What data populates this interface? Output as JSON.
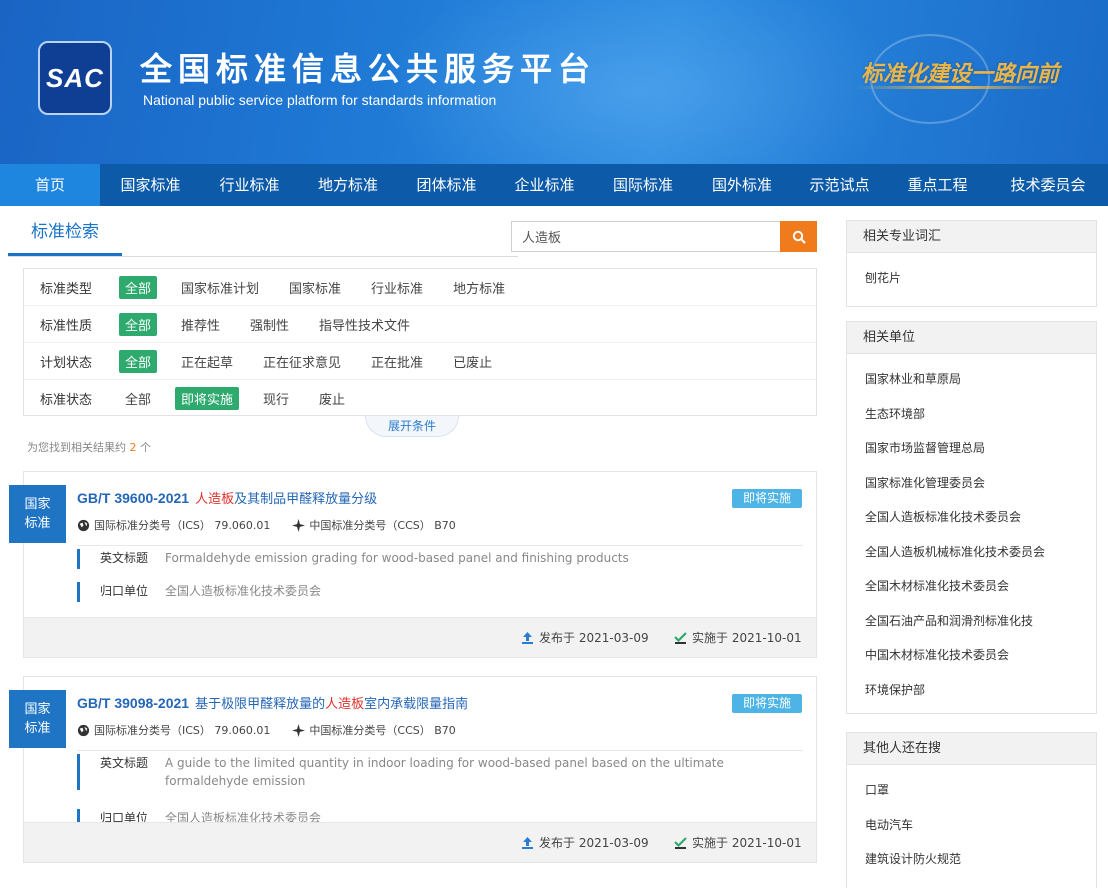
{
  "header": {
    "logo_text": "SAC",
    "title": "全国标准信息公共服务平台",
    "subtitle": "National public service platform  for standards information",
    "slogan": "标准化建设一路向前"
  },
  "nav": [
    {
      "label": "首页",
      "active": true
    },
    {
      "label": "国家标准"
    },
    {
      "label": "行业标准"
    },
    {
      "label": "地方标准"
    },
    {
      "label": "团体标准"
    },
    {
      "label": "企业标准"
    },
    {
      "label": "国际标准"
    },
    {
      "label": "国外标准"
    },
    {
      "label": "示范试点"
    },
    {
      "label": "重点工程"
    },
    {
      "label": "技术委员会"
    }
  ],
  "search": {
    "tab_label": "标准检索",
    "query": "人造板"
  },
  "filters": {
    "expand_label": "展开条件",
    "rows": [
      {
        "label": "标准类型",
        "options": [
          "全部",
          "国家标准计划",
          "国家标准",
          "行业标准",
          "地方标准"
        ],
        "selected": 0
      },
      {
        "label": "标准性质",
        "options": [
          "全部",
          "推荐性",
          "强制性",
          "指导性技术文件"
        ],
        "selected": 0
      },
      {
        "label": "计划状态",
        "options": [
          "全部",
          "正在起草",
          "正在征求意见",
          "正在批准",
          "已废止"
        ],
        "selected": 0
      },
      {
        "label": "标准状态",
        "options": [
          "全部",
          "即将实施",
          "现行",
          "废止"
        ],
        "selected": 1
      }
    ]
  },
  "result_summary": {
    "prefix": "为您找到相关结果约",
    "count": "2",
    "suffix": "个"
  },
  "results": [
    {
      "badge_line1": "国家",
      "badge_line2": "标准",
      "code": "GB/T 39600-2021",
      "title_highlight": "人造板",
      "title_rest": "及其制品甲醛释放量分级",
      "title_before": "",
      "status": "即将实施",
      "ics_label": "国际标准分类号（ICS）",
      "ics_value": "79.060.01",
      "ccs_label": "中国标准分类号（CCS）",
      "ccs_value": "B70",
      "en_name_label": "英文标题",
      "en_name": "Formaldehyde emission grading for wood-based panel and finishing products",
      "owner_label": "归口单位",
      "owner": "全国人造板标准化技术委员会",
      "publish_label": "发布于",
      "publish_date": "2021-03-09",
      "effective_label": "实施于",
      "effective_date": "2021-10-01"
    },
    {
      "badge_line1": "国家",
      "badge_line2": "标准",
      "code": "GB/T 39098-2021",
      "title_before": "基于极限甲醛释放量的",
      "title_highlight": "人造板",
      "title_rest": "室内承载限量指南",
      "status": "即将实施",
      "ics_label": "国际标准分类号（ICS）",
      "ics_value": "79.060.01",
      "ccs_label": "中国标准分类号（CCS）",
      "ccs_value": "B70",
      "en_name_label": "英文标题",
      "en_name": "A guide to the limited quantity in indoor loading for wood-based panel based on the ultimate formaldehyde emission",
      "owner_label": "归口单位",
      "owner": "全国人造板标准化技术委员会",
      "publish_label": "发布于",
      "publish_date": "2021-03-09",
      "effective_label": "实施于",
      "effective_date": "2021-10-01"
    }
  ],
  "sidebar": {
    "related_terms": {
      "title": "相关专业词汇",
      "items": [
        "刨花片"
      ]
    },
    "related_units": {
      "title": "相关单位",
      "items": [
        "国家林业和草原局",
        "生态环境部",
        "国家市场监督管理总局",
        "国家标准化管理委员会",
        "全国人造板标准化技术委员会",
        "全国人造板机械标准化技术委员会",
        "全国木材标准化技术委员会",
        "全国石油产品和润滑剂标准化技",
        "中国木材标准化技术委员会",
        "环境保护部"
      ]
    },
    "also_searched": {
      "title": "其他人还在搜",
      "items": [
        "口罩",
        "电动汽车",
        "建筑设计防火规范"
      ]
    }
  },
  "colors": {
    "header_blue": "#1f7ad6",
    "nav_blue": "#0d5ba8",
    "nav_active": "#1f86e0",
    "accent_orange": "#f07b1c",
    "selected_green": "#2eaa6e",
    "status_blue": "#4eb4e6",
    "highlight_red": "#e0322b"
  }
}
